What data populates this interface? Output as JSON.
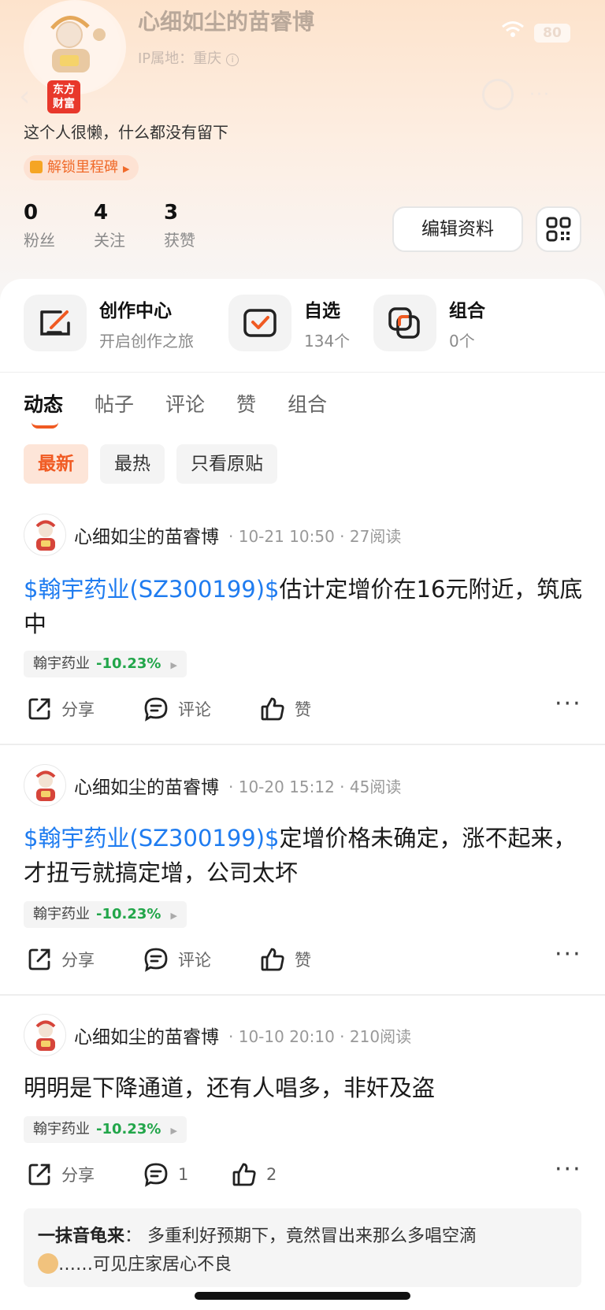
{
  "status": {
    "battery": "80"
  },
  "profile": {
    "name": "心细如尘的苗睿博",
    "ip_location": "IP属地：重庆",
    "brand_badge": "东方\n财富",
    "bio": "这个人很懒，什么都没有留下",
    "milestone": "解锁里程碑",
    "stats": [
      {
        "value": "0",
        "label": "粉丝"
      },
      {
        "value": "4",
        "label": "关注"
      },
      {
        "value": "3",
        "label": "获赞"
      }
    ],
    "edit_label": "编辑资料"
  },
  "shortcuts": [
    {
      "title": "创作中心",
      "sub": "开启创作之旅",
      "icon": "edit-icon"
    },
    {
      "title": "自选",
      "sub": "134个",
      "icon": "check-box-icon"
    },
    {
      "title": "组合",
      "sub": "0个",
      "icon": "portfolio-icon"
    }
  ],
  "tabs": [
    "动态",
    "帖子",
    "评论",
    "赞",
    "组合"
  ],
  "filters": [
    "最新",
    "最热",
    "只看原贴"
  ],
  "posts": [
    {
      "author": "心细如尘的苗睿博",
      "meta": "· 10-21 10:50 · 27阅读",
      "stock_link": "$翰宇药业(SZ300199)$",
      "text": "估计定增价在16元附近，筑底中",
      "chip_name": "翰宇药业",
      "chip_change": "-10.23%",
      "share": "分享",
      "comment": "评论",
      "like": "赞"
    },
    {
      "author": "心细如尘的苗睿博",
      "meta": "· 10-20 15:12 · 45阅读",
      "stock_link": "$翰宇药业(SZ300199)$",
      "text": "定增价格未确定，涨不起来，才扭亏就搞定增，公司太坏",
      "chip_name": "翰宇药业",
      "chip_change": "-10.23%",
      "share": "分享",
      "comment": "评论",
      "like": "赞"
    },
    {
      "author": "心细如尘的苗睿博",
      "meta": "· 10-10 20:10 · 210阅读",
      "stock_link": "",
      "text": "明明是下降通道，还有人唱多，非奸及盗",
      "chip_name": "翰宇药业",
      "chip_change": "-10.23%",
      "share": "分享",
      "comment": "1",
      "like": "2"
    }
  ],
  "top_comment": {
    "author": "一抹音龟来",
    "text": "多重利好预期下，竟然冒出来那么多唱空滴",
    "text2": "……可见庄家居心不良"
  },
  "colors": {
    "accent": "#f05a22",
    "link": "#1f7cf0",
    "down": "#22a64a"
  }
}
